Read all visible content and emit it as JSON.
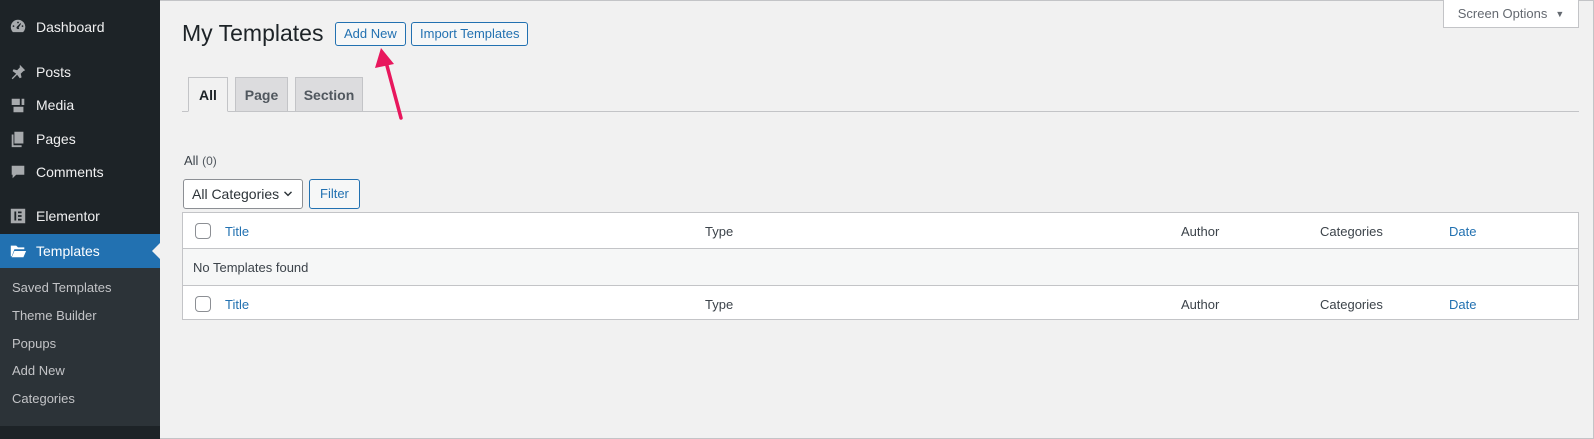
{
  "sidebar": {
    "items": [
      {
        "label": "Dashboard",
        "icon": "dashboard-icon"
      },
      {
        "label": "Posts",
        "icon": "pin-icon"
      },
      {
        "label": "Media",
        "icon": "media-icon"
      },
      {
        "label": "Pages",
        "icon": "pages-icon"
      },
      {
        "label": "Comments",
        "icon": "comment-icon"
      },
      {
        "label": "Elementor",
        "icon": "elementor-icon"
      },
      {
        "label": "Templates",
        "icon": "folder-icon"
      }
    ],
    "active": "Templates",
    "submenu": [
      "Saved Templates",
      "Theme Builder",
      "Popups",
      "Add New",
      "Categories"
    ]
  },
  "header": {
    "title": "My Templates",
    "add_new_label": "Add New",
    "import_label": "Import Templates",
    "screen_options_label": "Screen Options"
  },
  "tabs": [
    {
      "label": "All",
      "active": true
    },
    {
      "label": "Page",
      "active": false
    },
    {
      "label": "Section",
      "active": false
    }
  ],
  "filters": {
    "all_label": "All",
    "all_count": "(0)",
    "category_select": "All Categories",
    "filter_button": "Filter"
  },
  "table": {
    "columns": [
      "Title",
      "Type",
      "Author",
      "Categories",
      "Date"
    ],
    "empty_message": "No Templates found"
  },
  "colors": {
    "accent": "#2271b1",
    "sidebar_bg": "#1d2327",
    "annotation_arrow": "#e8175d"
  }
}
